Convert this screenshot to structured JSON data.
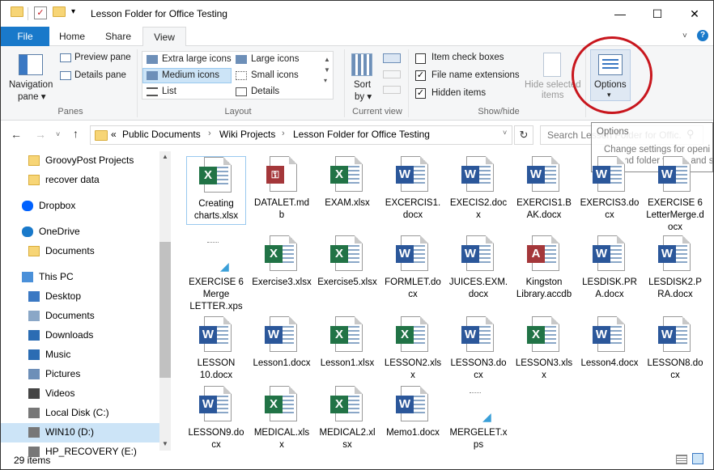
{
  "window": {
    "title": "Lesson Folder for Office Testing",
    "minimize": "—",
    "maximize": "☐",
    "close": "✕"
  },
  "tabs": {
    "file": "File",
    "home": "Home",
    "share": "Share",
    "view": "View"
  },
  "ribbon": {
    "navigation_pane": "Navigation",
    "navigation_pane2": "pane ▾",
    "preview_pane": "Preview pane",
    "details_pane": "Details pane",
    "panes_group": "Panes",
    "extra_large_icons": "Extra large icons",
    "large_icons": "Large icons",
    "medium_icons": "Medium icons",
    "small_icons": "Small icons",
    "list": "List",
    "details": "Details",
    "layout_group": "Layout",
    "sort_by": "Sort",
    "sort_by2": "by ▾",
    "current_view_group": "Current view",
    "item_check_boxes": "Item check boxes",
    "file_name_extensions": "File name extensions",
    "hidden_items": "Hidden items",
    "hide_selected": "Hide selected",
    "hide_selected2": "items",
    "show_hide_group": "Show/hide",
    "options": "Options",
    "options_arrow": "▾",
    "item_check_boxes_checked": false,
    "file_name_extensions_checked": true,
    "hidden_items_checked": true
  },
  "tooltip": {
    "title": "Options",
    "text1": "Change settings for openi",
    "text2": "file and folder views, and s"
  },
  "address": {
    "prefix": "«",
    "crumbs": [
      "Public Documents",
      "Wiki Projects",
      "Lesson Folder for Office Testing"
    ],
    "search_placeholder": "Search Lesson Folder for Offic..."
  },
  "nav": [
    {
      "label": "GroovyPost Projects",
      "icon": "folder"
    },
    {
      "label": "recover data",
      "icon": "folder"
    },
    {
      "label": "Dropbox",
      "icon": "dropbox"
    },
    {
      "label": "OneDrive",
      "icon": "cloud"
    },
    {
      "label": "Documents",
      "icon": "folder"
    },
    {
      "label": "This PC",
      "icon": "pc"
    },
    {
      "label": "Desktop",
      "icon": "desktop"
    },
    {
      "label": "Documents",
      "icon": "documents"
    },
    {
      "label": "Downloads",
      "icon": "downloads"
    },
    {
      "label": "Music",
      "icon": "music"
    },
    {
      "label": "Pictures",
      "icon": "pictures"
    },
    {
      "label": "Videos",
      "icon": "videos"
    },
    {
      "label": "Local Disk (C:)",
      "icon": "disk"
    },
    {
      "label": "WIN10 (D:)",
      "icon": "disk"
    },
    {
      "label": "HP_RECOVERY (E:)",
      "icon": "disk"
    }
  ],
  "files": [
    {
      "name": "Creating charts.xlsx",
      "type": "excel"
    },
    {
      "name": "DATALET.mdb",
      "type": "access"
    },
    {
      "name": "EXAM.xlsx",
      "type": "excel"
    },
    {
      "name": "EXCERCIS1.docx",
      "type": "word"
    },
    {
      "name": "EXECIS2.docx",
      "type": "word"
    },
    {
      "name": "EXERCIS1.BAK.docx",
      "type": "word"
    },
    {
      "name": "EXERCIS3.docx",
      "type": "word"
    },
    {
      "name": "EXERCISE 6 LetterMerge.docx",
      "type": "word"
    },
    {
      "name": "EXERCISE 6 Merge LETTER.xps",
      "type": "xps"
    },
    {
      "name": "Exercise3.xlsx",
      "type": "excel"
    },
    {
      "name": "Exercise5.xlsx",
      "type": "excel"
    },
    {
      "name": "FORMLET.docx",
      "type": "word"
    },
    {
      "name": "JUICES.EXM.docx",
      "type": "word"
    },
    {
      "name": "Kingston Library.accdb",
      "type": "accdb"
    },
    {
      "name": "LESDISK.PRA.docx",
      "type": "word"
    },
    {
      "name": "LESDISK2.PRA.docx",
      "type": "word"
    },
    {
      "name": "LESSON 10.docx",
      "type": "word"
    },
    {
      "name": "Lesson1.docx",
      "type": "word"
    },
    {
      "name": "Lesson1.xlsx",
      "type": "excel"
    },
    {
      "name": "LESSON2.xlsx",
      "type": "excel"
    },
    {
      "name": "LESSON3.docx",
      "type": "word"
    },
    {
      "name": "LESSON3.xlsx",
      "type": "excel"
    },
    {
      "name": "Lesson4.docx",
      "type": "word"
    },
    {
      "name": "LESSON8.docx",
      "type": "word"
    },
    {
      "name": "LESSON9.docx",
      "type": "word"
    },
    {
      "name": "MEDICAL.xlsx",
      "type": "excel"
    },
    {
      "name": "MEDICAL2.xlsx",
      "type": "excel"
    },
    {
      "name": "Memo1.docx",
      "type": "word"
    },
    {
      "name": "MERGELET.xps",
      "type": "xps"
    }
  ],
  "status": {
    "count": "29 items"
  },
  "colors": {
    "word": "#2b579a",
    "excel": "#217346",
    "access": "#a4373a",
    "accent": "#1979ca",
    "highlight_circle": "#c8161d"
  }
}
